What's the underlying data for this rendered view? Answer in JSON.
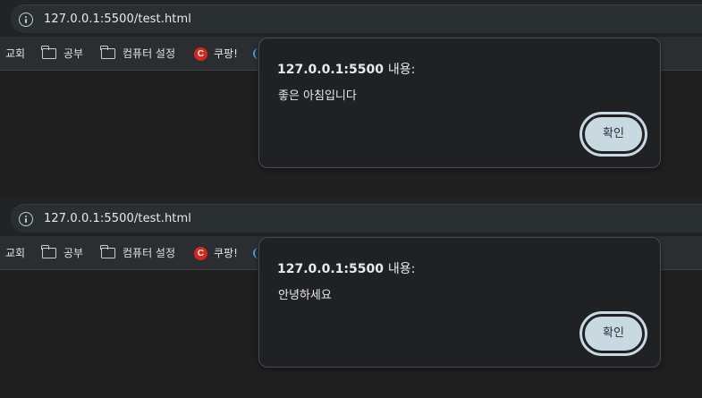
{
  "panels": [
    {
      "url": "127.0.0.1:5500/test.html",
      "bookmarks": [
        {
          "label": "교회"
        },
        {
          "label": "공부"
        },
        {
          "label": "컴퓨터 설정"
        },
        {
          "label": "쿠팡!"
        }
      ],
      "dialog": {
        "origin": "127.0.0.1:5500",
        "title_suffix": "내용:",
        "message": "좋은 아침입니다",
        "ok_label": "확인"
      }
    },
    {
      "url": "127.0.0.1:5500/test.html",
      "bookmarks": [
        {
          "label": "교회"
        },
        {
          "label": "공부"
        },
        {
          "label": "컴퓨터 설정"
        },
        {
          "label": "쿠팡!"
        }
      ],
      "dialog": {
        "origin": "127.0.0.1:5500",
        "title_suffix": "내용:",
        "message": "안녕하세요",
        "ok_label": "확인"
      }
    }
  ],
  "colors": {
    "page_background": "#1f1f1f",
    "dialog_background": "#202124",
    "button_background": "#c9d9e2",
    "coupang_icon": "#d9261c"
  },
  "icons": [
    "info-icon",
    "folder-icon",
    "coupang-icon"
  ]
}
